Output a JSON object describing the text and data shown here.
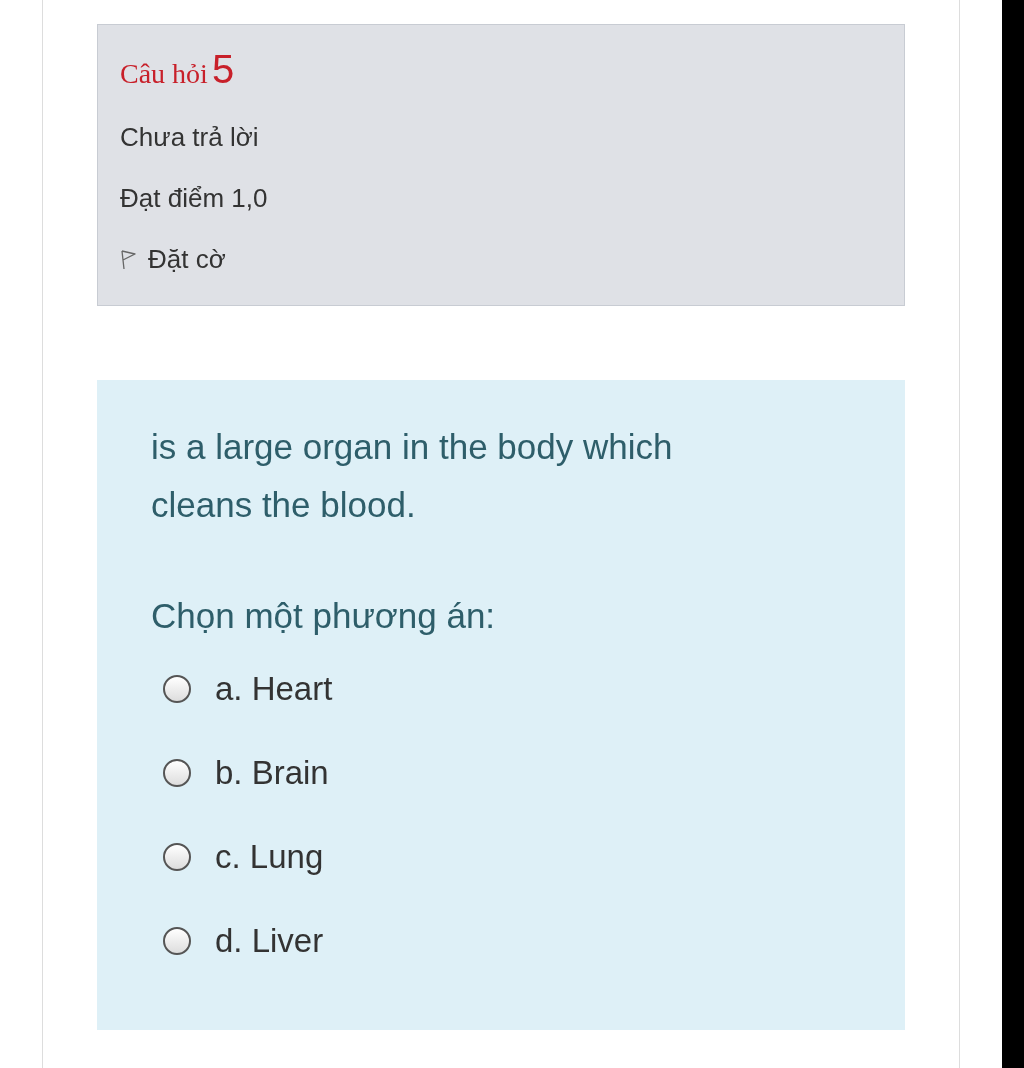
{
  "info": {
    "question_label": "Câu hỏi",
    "question_number": "5",
    "status": "Chưa trả lời",
    "mark": "Đạt điểm 1,0",
    "flag": {
      "label": "Đặt cờ",
      "flagged": false
    }
  },
  "question": {
    "text": "is a large organ in the body which cleans the blood.",
    "prompt": "Chọn một phương án:",
    "options": [
      {
        "label": "a. Heart",
        "selected": false
      },
      {
        "label": "b. Brain",
        "selected": false
      },
      {
        "label": "c. Lung",
        "selected": false
      },
      {
        "label": "d. Liver",
        "selected": false
      }
    ]
  }
}
